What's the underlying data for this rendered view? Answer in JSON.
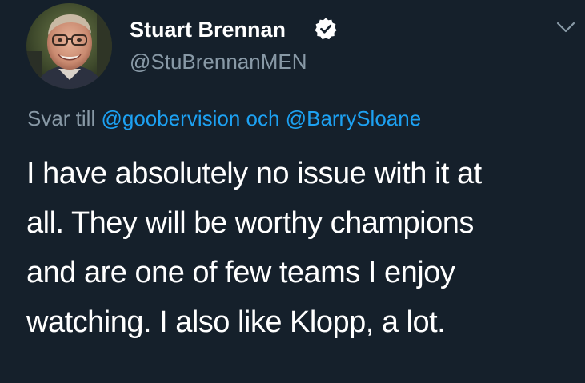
{
  "author": {
    "display_name": "Stuart Brennan",
    "handle": "@StuBrennanMEN",
    "verified": true,
    "avatar_icon": "profile-photo"
  },
  "reply": {
    "prefix": "Svar till",
    "mention_1": "@goobervision",
    "conjunction": "och",
    "mention_2": "@BarrySloane"
  },
  "tweet": {
    "lines": [
      "I have absolutely no issue with it at",
      "all. They will be worthy champions",
      "and are one of few teams I enjoy",
      "watching. I also like Klopp, a lot."
    ]
  },
  "icons": {
    "verified": "verified-badge-icon",
    "menu": "chevron-down-icon"
  },
  "colors": {
    "background": "#15202b",
    "text": "#ffffff",
    "secondary": "#8899a6",
    "link": "#1da1f2"
  }
}
